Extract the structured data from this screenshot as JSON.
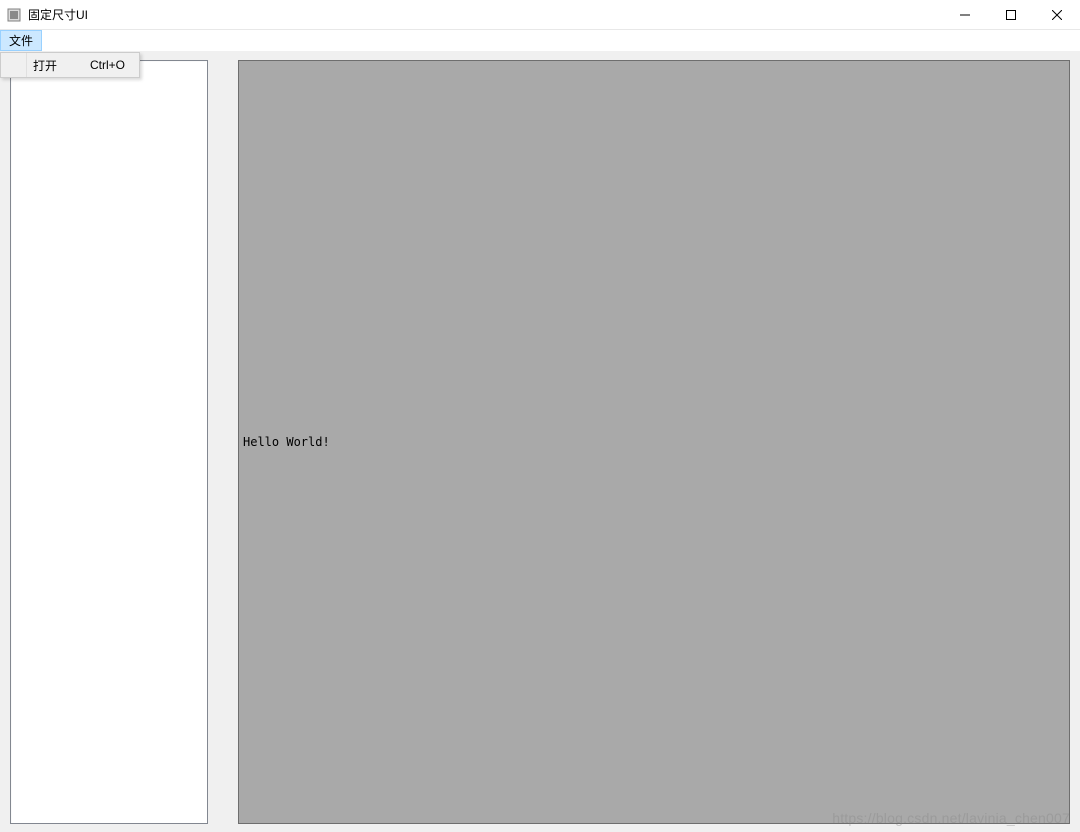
{
  "window": {
    "title": "固定尺寸UI",
    "controls": {
      "minimize": "minimize",
      "maximize": "maximize",
      "close": "close"
    }
  },
  "menubar": {
    "file": {
      "label": "文件",
      "items": [
        {
          "label": "打开",
          "shortcut": "Ctrl+O"
        }
      ]
    }
  },
  "main": {
    "content_text": "Hello World!"
  },
  "watermark": "https://blog.csdn.net/lavinia_chen007"
}
